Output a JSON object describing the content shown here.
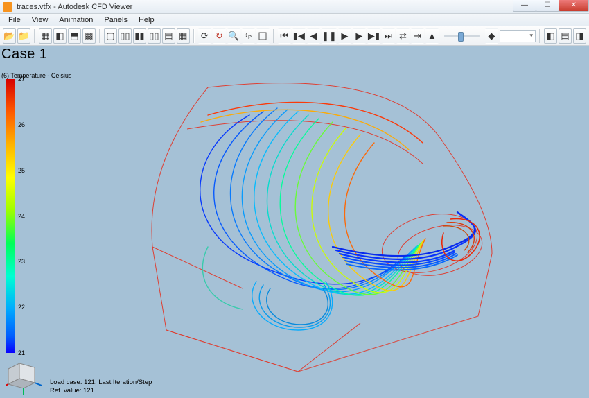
{
  "window": {
    "title": "traces.vtfx - Autodesk CFD Viewer"
  },
  "menubar": [
    "File",
    "View",
    "Animation",
    "Panels",
    "Help"
  ],
  "viewport": {
    "case_label": "Case 1",
    "legend_title": "(6) Temperature - Celsius",
    "legend_ticks": [
      {
        "value": "27",
        "pct": 0
      },
      {
        "value": "26",
        "pct": 16.7
      },
      {
        "value": "25",
        "pct": 33.3
      },
      {
        "value": "24",
        "pct": 50
      },
      {
        "value": "23",
        "pct": 66.7
      },
      {
        "value": "22",
        "pct": 83.3
      },
      {
        "value": "21",
        "pct": 100
      }
    ],
    "status_line1": "Load case: 121, Last Iteration/Step",
    "status_line2": "Ref. value: 121"
  },
  "icons": {
    "open": "📂",
    "folder": "📁",
    "refresh": "⟳",
    "cycle": "↻",
    "zoom": "🔍",
    "config": "≡",
    "first": "⏮",
    "prevkey": "▮◀",
    "prev": "◀",
    "pause": "❚❚",
    "play": "▶",
    "next": "▶",
    "nextkey": "▶▮",
    "last": "⏭",
    "loop": "↺",
    "once": "↪",
    "marker1": "▲",
    "marker2": "◆",
    "panel1": "◧",
    "panel2": "▤",
    "panel3": "◨"
  }
}
